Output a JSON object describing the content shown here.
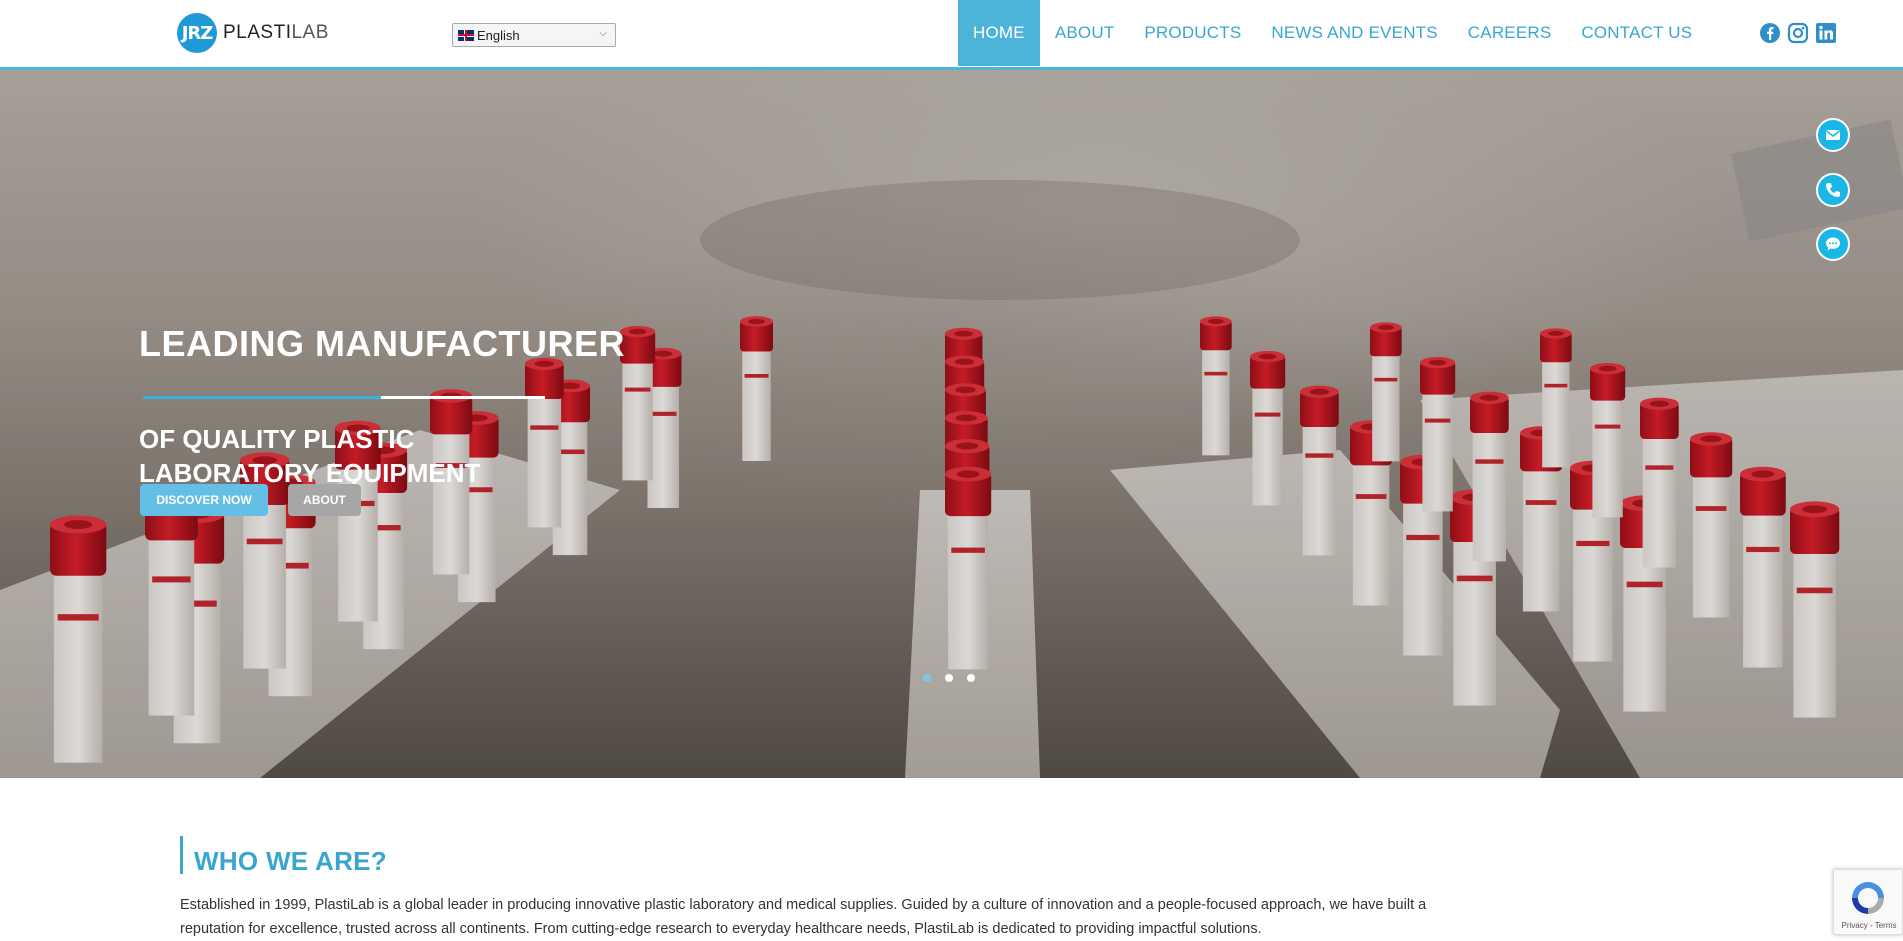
{
  "header": {
    "logo_mark": "JRZ",
    "logo_text_bold": "PLASTI",
    "logo_text_light": "LAB",
    "language": "English",
    "nav": [
      "HOME",
      "ABOUT",
      "PRODUCTS",
      "NEWS AND EVENTS",
      "CAREERS",
      "CONTACT US"
    ],
    "active_nav": "HOME",
    "social": [
      "facebook-icon",
      "instagram-icon",
      "linkedin-icon"
    ],
    "accent_color": "#4bb4d8"
  },
  "hero": {
    "title": "LEADING MANUFACTURER",
    "subtitle_line1": "OF QUALITY PLASTIC",
    "subtitle_line2": "LABORATORY EQUIPMENT",
    "btn_discover": "DISCOVER NOW",
    "btn_about": "ABOUT",
    "slides": 3,
    "active_slide": 1
  },
  "floating": [
    "email-icon",
    "phone-icon",
    "chat-icon"
  ],
  "who": {
    "title": "WHO WE ARE?",
    "text": "Established in 1999, PlastiLab is a global leader in producing innovative plastic laboratory and medical supplies. Guided by a culture of innovation and a people-focused approach, we have built a reputation for excellence, trusted across all continents. From cutting-edge research to everyday healthcare needs, PlastiLab is dedicated to providing impactful solutions."
  },
  "recaptcha": {
    "text": "Privacy - Terms"
  }
}
